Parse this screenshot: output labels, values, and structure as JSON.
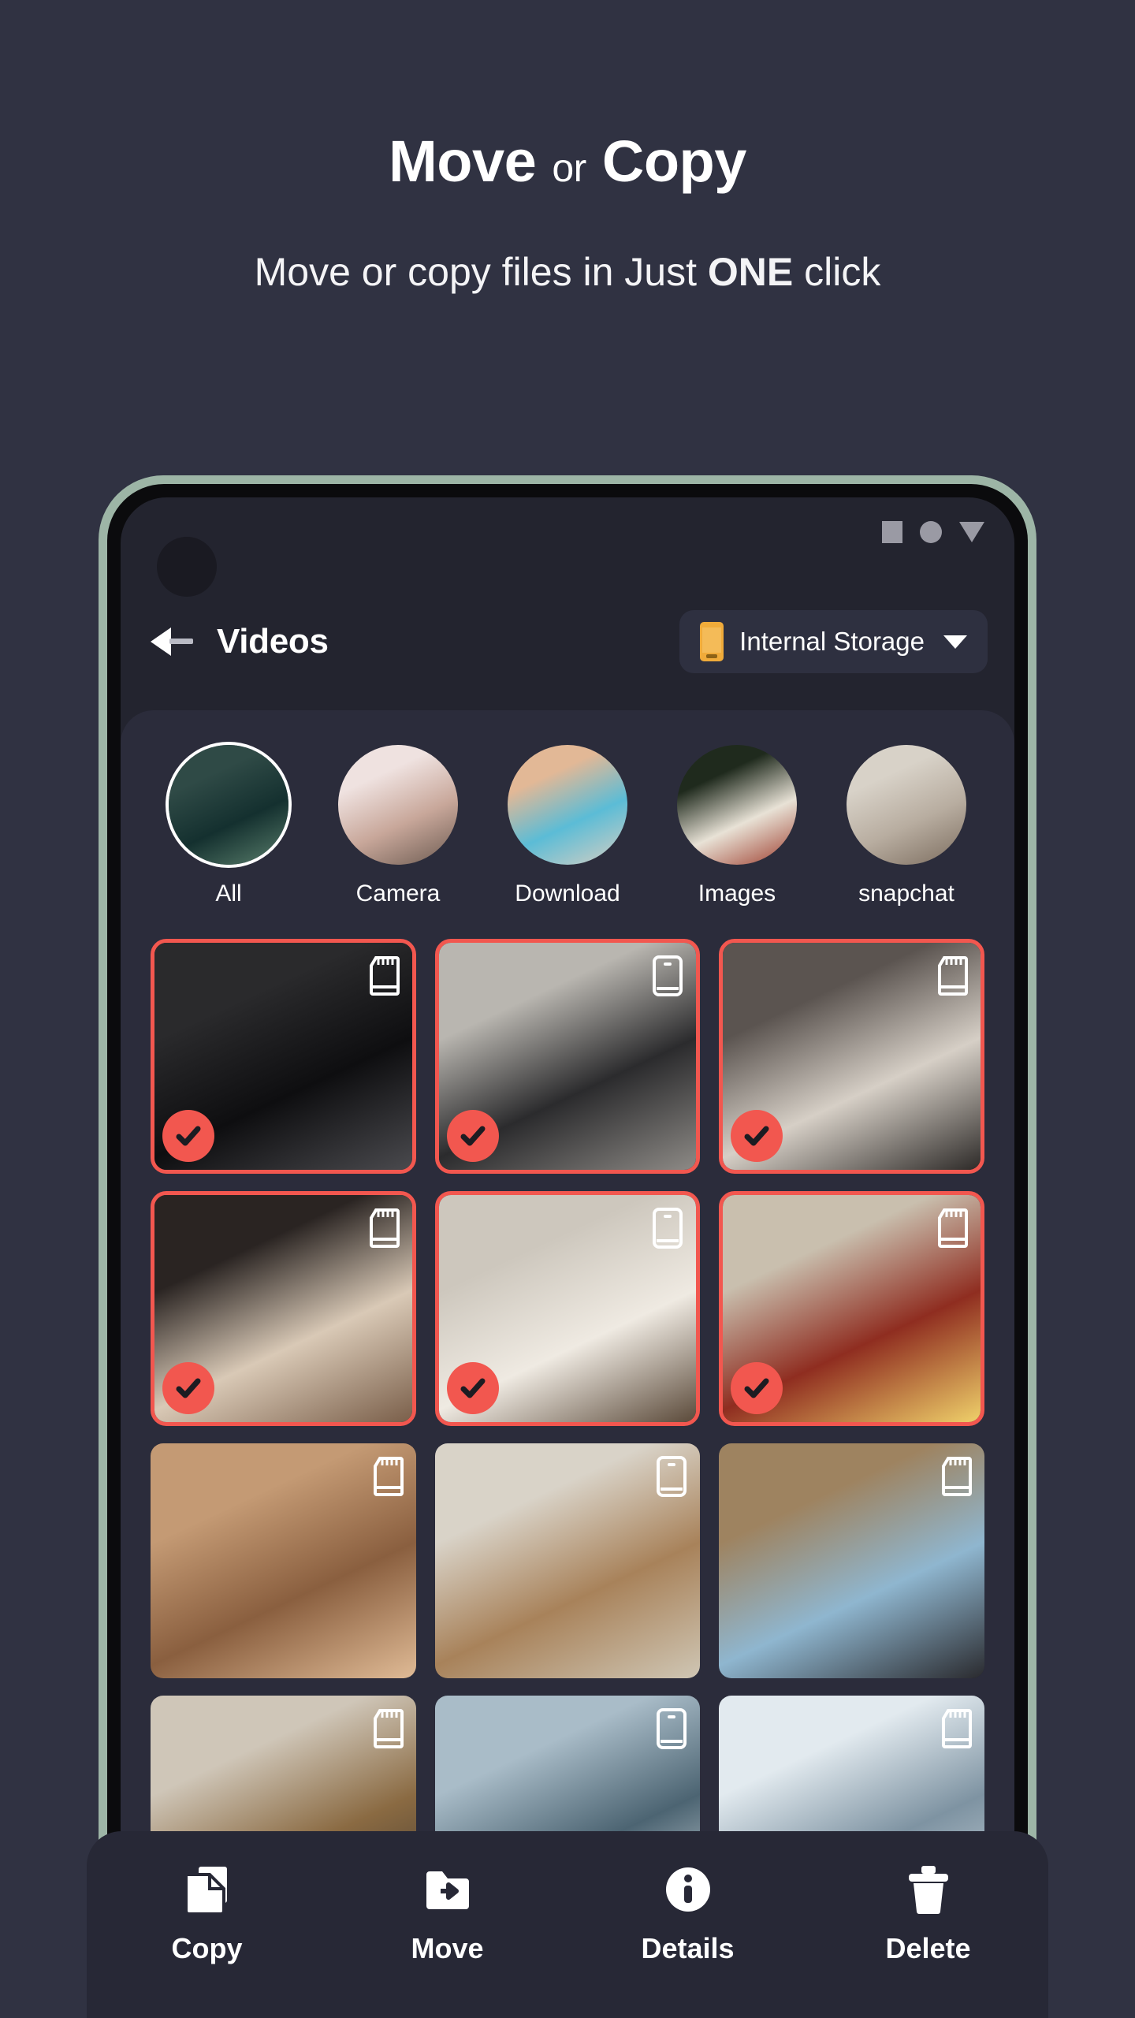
{
  "hero": {
    "title_strong_1": "Move",
    "title_light": "or",
    "title_strong_2": "Copy",
    "subtitle_pre": "Move or copy files in Just ",
    "subtitle_bold": "ONE",
    "subtitle_post": " click"
  },
  "colors": {
    "page_background": "#303242",
    "phone_frame": "#9db5a6",
    "phone_bezel": "#0b0b0d",
    "screen_background": "#23242f",
    "content_card": "#2b2c3b",
    "accent_selection": "#f2574f",
    "storage_icon": "#f0ab3a",
    "bottom_bar": "#272836",
    "text_primary": "#ffffff"
  },
  "phone": {
    "statusbar": {
      "icons": [
        "square-icon",
        "circle-icon",
        "triangle-down-icon"
      ]
    },
    "appbar": {
      "back_icon": "back-arrow-icon",
      "title": "Videos",
      "storage_selector": {
        "icon": "phone-storage-icon",
        "label": "Internal Storage",
        "chevron": "chevron-down-icon"
      }
    },
    "folders": [
      {
        "name": "All",
        "active": true,
        "img": "person-blue-jacket"
      },
      {
        "name": "Camera",
        "active": false,
        "img": "woman-beach-hat"
      },
      {
        "name": "Download",
        "active": false,
        "img": "woman-blue-hair-flowers"
      },
      {
        "name": "Images",
        "active": false,
        "img": "woman-plants-lamp"
      },
      {
        "name": "snapchat",
        "active": false,
        "img": "woman-white-gown"
      }
    ],
    "grid": [
      {
        "id": "tile-1",
        "selected": true,
        "storage": "sd-card-icon",
        "img": "portrait-glasses-dark"
      },
      {
        "id": "tile-2",
        "selected": true,
        "storage": "phone-icon",
        "img": "person-black-hat-coat"
      },
      {
        "id": "tile-3",
        "selected": true,
        "storage": "sd-card-icon",
        "img": "woman-sunglasses-street"
      },
      {
        "id": "tile-4",
        "selected": true,
        "storage": "sd-card-icon",
        "img": "woman-top-hat"
      },
      {
        "id": "tile-5",
        "selected": true,
        "storage": "phone-icon",
        "img": "woman-white-shirt-cafe"
      },
      {
        "id": "tile-6",
        "selected": true,
        "storage": "sd-card-icon",
        "img": "skillet-eggs-food"
      },
      {
        "id": "tile-7",
        "selected": false,
        "storage": "sd-card-icon",
        "img": "woman-shadow-wall"
      },
      {
        "id": "tile-8",
        "selected": false,
        "storage": "phone-icon",
        "img": "couple-country-road"
      },
      {
        "id": "tile-9",
        "selected": false,
        "storage": "sd-card-icon",
        "img": "blm-protest-signs"
      },
      {
        "id": "tile-10",
        "selected": false,
        "storage": "sd-card-icon",
        "img": "cabin-interior-wood"
      },
      {
        "id": "tile-11",
        "selected": false,
        "storage": "phone-icon",
        "img": "misty-mountains"
      },
      {
        "id": "tile-12",
        "selected": false,
        "storage": "sd-card-icon",
        "img": "snowy-peaks-phone"
      }
    ]
  },
  "bottom_bar": {
    "actions": [
      {
        "label": "Copy",
        "icon": "copy-icon"
      },
      {
        "label": "Move",
        "icon": "folder-move-icon"
      },
      {
        "label": "Details",
        "icon": "info-circle-icon"
      },
      {
        "label": "Delete",
        "icon": "trash-icon"
      }
    ]
  }
}
